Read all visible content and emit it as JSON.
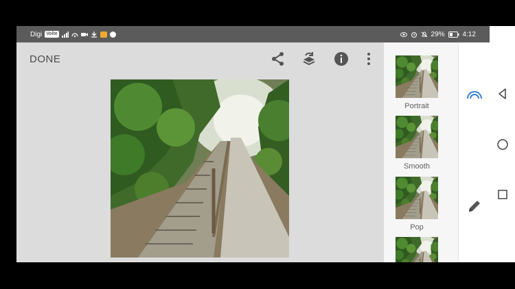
{
  "status_bar": {
    "carrier": "Digi",
    "net_badge": "Volte",
    "battery": "29%",
    "time": "4:12"
  },
  "toolbar": {
    "done_label": "DONE",
    "icons": [
      "share-icon",
      "layers-icon",
      "info-icon",
      "more-vert-icon"
    ]
  },
  "looks": [
    {
      "label": "Portrait"
    },
    {
      "label": "Smooth"
    },
    {
      "label": "Pop"
    },
    {
      "label": ""
    }
  ],
  "side_tools": [
    "looks-icon",
    "edit-pencil-icon"
  ],
  "nav": [
    "back-icon",
    "home-icon",
    "recents-icon"
  ],
  "colors": {
    "status_bar": "#5b5b5b",
    "canvas_bg": "#dcdcdc",
    "looks_panel": "#f6f6f6",
    "accent": "#3b7fd4"
  }
}
